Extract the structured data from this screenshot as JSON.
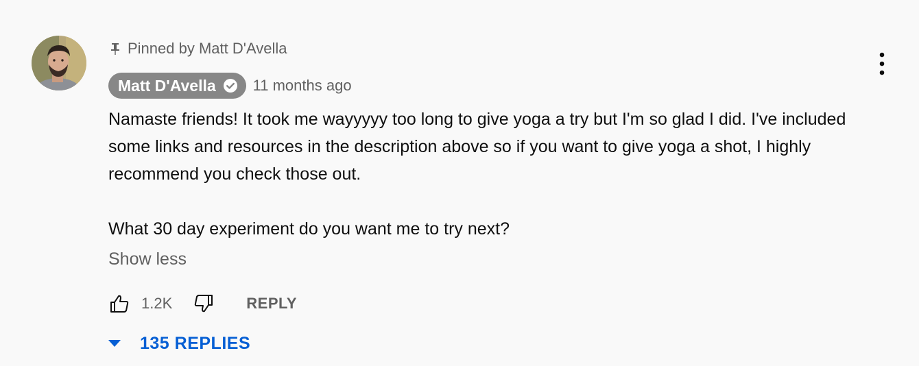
{
  "pinned": {
    "icon": "pin-icon",
    "label": "Pinned by Matt D'Avella"
  },
  "author": {
    "name": "Matt D'Avella",
    "verified_icon": "verified-check-icon",
    "badge_color": "#878787"
  },
  "timestamp": "11 months ago",
  "body": {
    "paragraph_1": "Namaste friends! It took me wayyyyy too long to give yoga a try but I'm so glad I did. I've included some links and resources in the description above so if you want to give yoga a shot, I highly recommend you check those out.",
    "paragraph_2": "What 30 day experiment do you want me to try next?"
  },
  "show_less_label": "Show less",
  "actions": {
    "like_icon": "thumbs-up-icon",
    "like_count": "1.2K",
    "dislike_icon": "thumbs-down-icon",
    "reply_label": "REPLY"
  },
  "replies": {
    "icon": "caret-down-icon",
    "label": "135 REPLIES",
    "color": "#065fd4"
  },
  "menu_icon": "more-vertical-icon"
}
